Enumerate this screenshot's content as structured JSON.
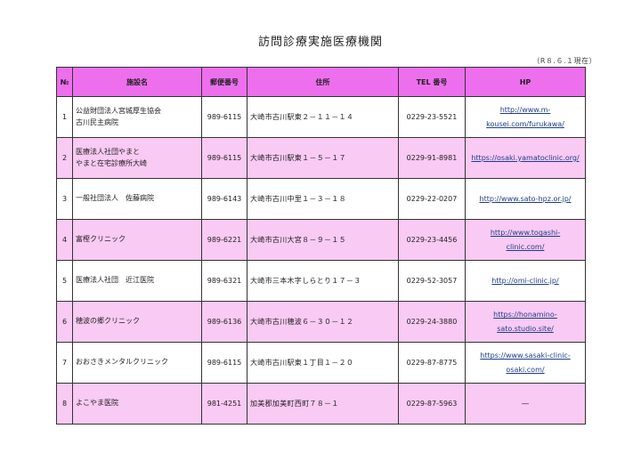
{
  "title": "訪問診療実施医療機関",
  "date_note": "（R８.６.１現在）",
  "table": {
    "headers": {
      "no": "№",
      "name": "施設名",
      "postal": "郵便番号",
      "address": "住所",
      "tel": "TEL 番号",
      "hp": "HP"
    },
    "rows": [
      {
        "no": "1",
        "name": [
          "公益財団法人宮城厚生協会",
          "古川民主病院"
        ],
        "postal": "989-6115",
        "address": "大崎市古川駅東２－１１－１４",
        "tel": "0229-23-5521",
        "hp": [
          "http://www.m-",
          "kousei.com/furukawa/"
        ],
        "hp_link": true
      },
      {
        "no": "2",
        "name": [
          "医療法人社団やまと",
          "やまと在宅診療所大崎"
        ],
        "postal": "989-6115",
        "address": "大崎市古川駅東１－５－１７",
        "tel": "0229-91-8981",
        "hp": [
          "https://osaki.yamatoclinic.org/"
        ],
        "hp_link": true
      },
      {
        "no": "3",
        "name": [
          "一般社団法人　佐藤病院"
        ],
        "postal": "989-6143",
        "address": "大崎市古川中里１－３－１８",
        "tel": "0229-22-0207",
        "hp": [
          "http://www.sato-hpz.or.jp/"
        ],
        "hp_link": true
      },
      {
        "no": "4",
        "name": [
          "富樫クリニック"
        ],
        "postal": "989-6221",
        "address": "大崎市古川大宮８－９－１５",
        "tel": "0229-23-4456",
        "hp": [
          "http://www.togashi-",
          "clinic.com/"
        ],
        "hp_link": true
      },
      {
        "no": "5",
        "name": [
          "医療法人社団　近江医院"
        ],
        "postal": "989-6321",
        "address": "大崎市三本木字しらとり１７－３",
        "tel": "0229-52-3057",
        "hp": [
          "http://omi-clinic.jp/"
        ],
        "hp_link": true
      },
      {
        "no": "6",
        "name": [
          "穂波の郷クリニック"
        ],
        "postal": "989-6136",
        "address": "大崎市古川穂波６－３０－１２",
        "tel": "0229-24-3880",
        "hp": [
          "https://honamino-",
          "sato.studio.site/"
        ],
        "hp_link": true
      },
      {
        "no": "7",
        "name": [
          "おおさきメンタルクリニック"
        ],
        "postal": "989-6115",
        "address": "大崎市古川駅東１丁目１－２０",
        "tel": "0229-87-8775",
        "hp": [
          "https://www.sasaki-clinic-",
          "osaki.com/"
        ],
        "hp_link": true
      },
      {
        "no": "8",
        "name": [
          "よこやま医院"
        ],
        "postal": "981-4251",
        "address": "加美郡加美町西町７８－１",
        "tel": "0229-87-5963",
        "hp": [
          "―"
        ],
        "hp_link": false
      }
    ]
  }
}
